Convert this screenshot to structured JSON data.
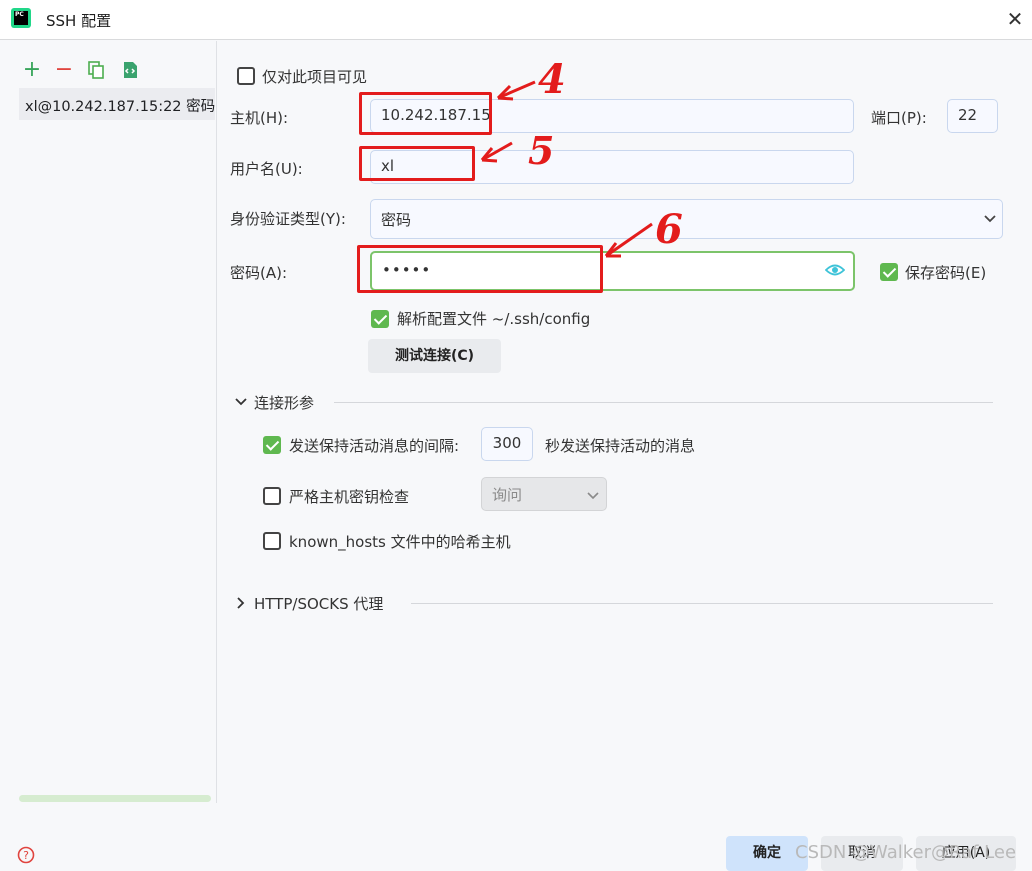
{
  "window": {
    "title": "SSH 配置"
  },
  "app_icon": {
    "text": "PC",
    "name": "pycharm-icon"
  },
  "toolbar": {
    "icons": [
      "add-icon",
      "remove-icon",
      "copy-icon",
      "export-icon"
    ],
    "add_glyph": "+",
    "remove_glyph": "−"
  },
  "server_list": {
    "items": [
      {
        "label": "xl@10.242.187.15:22 密码"
      }
    ]
  },
  "form": {
    "visible_only_project": {
      "label": "仅对此项目可见",
      "checked": false
    },
    "host": {
      "label": "主机(H):",
      "value": "10.242.187.15"
    },
    "port": {
      "label": "端口(P):",
      "value": "22"
    },
    "username": {
      "label": "用户名(U):",
      "value": "xl"
    },
    "auth_type": {
      "label": "身份验证类型(Y):",
      "value": "密码"
    },
    "password": {
      "label": "密码(A):",
      "value": "•••••"
    },
    "save_password": {
      "label": "保存密码(E)",
      "checked": true
    },
    "parse_config": {
      "label": "解析配置文件 ~/.ssh/config",
      "checked": true
    },
    "test_connection": {
      "label": "测试连接(C)"
    }
  },
  "connection_params": {
    "title": "连接形参",
    "keepalive": {
      "label": "发送保持活动消息的间隔:",
      "value": "300",
      "suffix": "秒发送保持活动的消息",
      "checked": true
    },
    "strict_host": {
      "label": "严格主机密钥检查",
      "value": "询问",
      "checked": false
    },
    "hash_hosts": {
      "label": "known_hosts 文件中的哈希主机",
      "checked": false
    }
  },
  "proxy_section": {
    "title": "HTTP/SOCKS 代理"
  },
  "annotations": [
    "4",
    "5",
    "6"
  ],
  "footer": {
    "ok": "确定",
    "cancel": "取消",
    "apply": "应用(A)",
    "watermark": "CSDN @Walker@Raf Lee"
  },
  "colors": {
    "accent": "#5fb84f",
    "annotation": "#e31c1c",
    "primary_button": "#cfe3fb"
  }
}
